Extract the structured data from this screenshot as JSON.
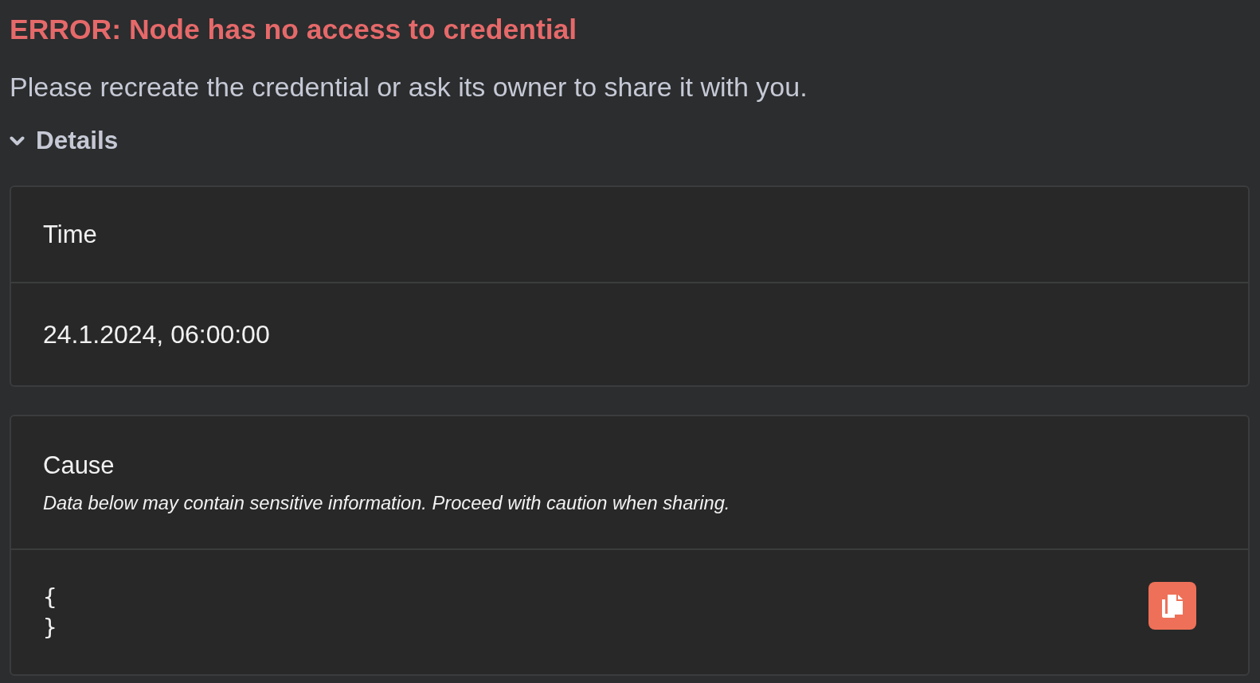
{
  "error": {
    "title": "ERROR: Node has no access to credential",
    "description": "Please recreate the credential or ask its owner to share it with you."
  },
  "details": {
    "label": "Details",
    "expanded": true,
    "sections": [
      {
        "kind": "text",
        "heading": "Time",
        "value": "24.1.2024, 06:00:00"
      },
      {
        "kind": "code",
        "heading": "Cause",
        "note": "Data below may contain sensitive information. Proceed with caution when sharing.",
        "code_lines": [
          "{",
          "}"
        ]
      }
    ]
  }
}
